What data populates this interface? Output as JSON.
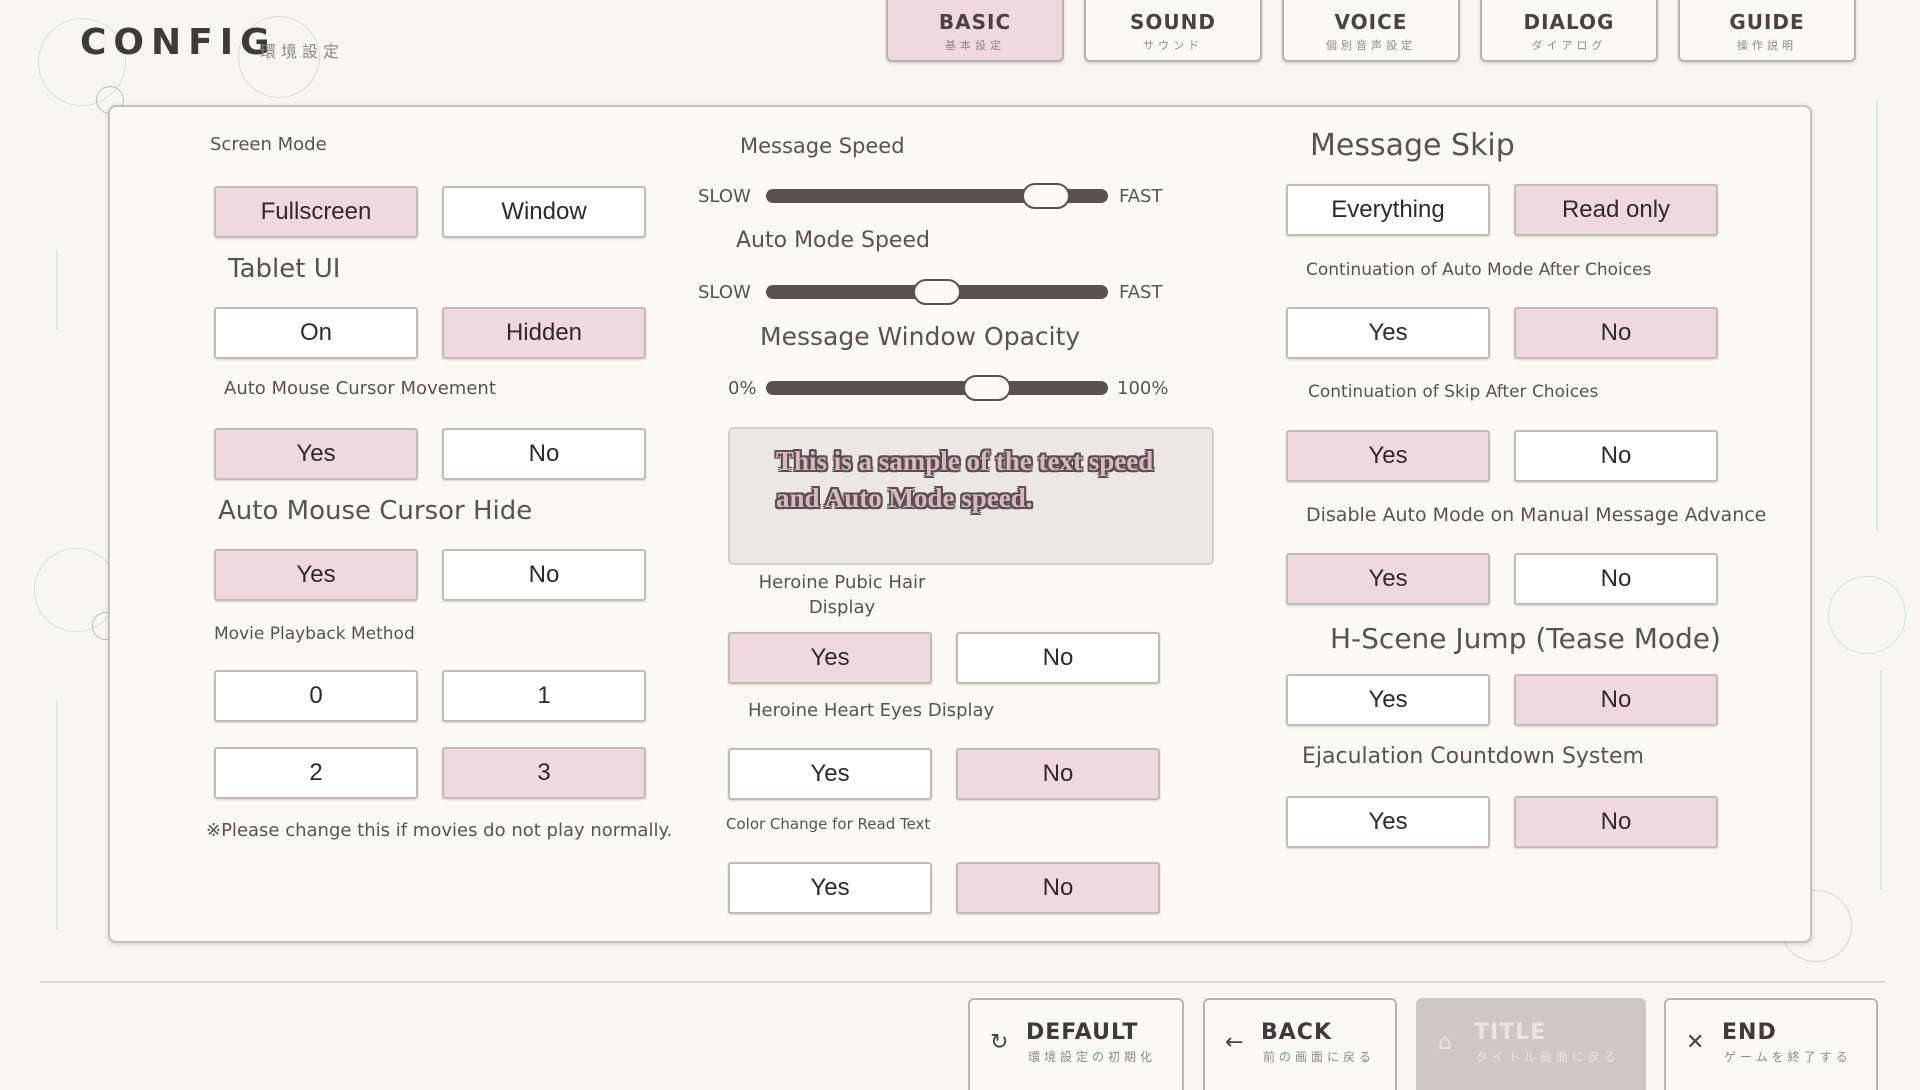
{
  "header": {
    "title": "CONFIG",
    "subtitle": "環境設定",
    "tabs": [
      {
        "label": "BASIC",
        "sub": "基本設定",
        "active": true
      },
      {
        "label": "SOUND",
        "sub": "サウンド",
        "active": false
      },
      {
        "label": "VOICE",
        "sub": "個別音声設定",
        "active": false
      },
      {
        "label": "DIALOG",
        "sub": "ダイアログ",
        "active": false
      },
      {
        "label": "GUIDE",
        "sub": "操作説明",
        "active": false
      }
    ]
  },
  "left": {
    "screen_mode": {
      "label": "Screen Mode",
      "options": [
        "Fullscreen",
        "Window"
      ],
      "selected": "Fullscreen"
    },
    "tablet_ui": {
      "label": "Tablet UI",
      "options": [
        "On",
        "Hidden"
      ],
      "selected": "Hidden"
    },
    "auto_cursor_move": {
      "label": "Auto Mouse Cursor Movement",
      "options": [
        "Yes",
        "No"
      ],
      "selected": "Yes"
    },
    "auto_cursor_hide": {
      "label": "Auto Mouse Cursor Hide",
      "options": [
        "Yes",
        "No"
      ],
      "selected": "Yes"
    },
    "movie_method": {
      "label": "Movie Playback Method",
      "options": [
        "0",
        "1",
        "2",
        "3"
      ],
      "selected": "3",
      "note": "※Please change this if movies do not play normally."
    }
  },
  "middle": {
    "message_speed": {
      "label": "Message Speed",
      "min_label": "SLOW",
      "max_label": "FAST",
      "value": 0.87
    },
    "auto_mode_speed": {
      "label": "Auto Mode Speed",
      "min_label": "SLOW",
      "max_label": "FAST",
      "value": 0.5
    },
    "window_opacity": {
      "label": "Message Window Opacity",
      "min_label": "0%",
      "max_label": "100%",
      "value": 0.67
    },
    "sample_text": "This is a sample of the text speed and Auto Mode speed.",
    "pubic_hair": {
      "label": "Heroine Pubic Hair Display",
      "options": [
        "Yes",
        "No"
      ],
      "selected": "Yes"
    },
    "heart_eyes": {
      "label": "Heroine Heart Eyes Display",
      "options": [
        "Yes",
        "No"
      ],
      "selected": "No"
    },
    "read_color": {
      "label": "Color Change for Read Text",
      "options": [
        "Yes",
        "No"
      ],
      "selected": "No"
    }
  },
  "right": {
    "message_skip": {
      "label": "Message Skip",
      "options": [
        "Everything",
        "Read only"
      ],
      "selected": "Read only"
    },
    "auto_after_choice": {
      "label": "Continuation of Auto Mode After Choices",
      "options": [
        "Yes",
        "No"
      ],
      "selected": "No"
    },
    "skip_after_choice": {
      "label": "Continuation of Skip After Choices",
      "options": [
        "Yes",
        "No"
      ],
      "selected": "Yes"
    },
    "disable_auto": {
      "label": "Disable Auto Mode on Manual Message Advance",
      "options": [
        "Yes",
        "No"
      ],
      "selected": "Yes"
    },
    "hscene_jump": {
      "label": "H-Scene Jump (Tease Mode)",
      "options": [
        "Yes",
        "No"
      ],
      "selected": "No"
    },
    "ejac_countdown": {
      "label": "Ejaculation Countdown System",
      "options": [
        "Yes",
        "No"
      ],
      "selected": "No"
    }
  },
  "footer": {
    "buttons": [
      {
        "label": "DEFAULT",
        "sub": "環境設定の初期化",
        "icon": "reset-icon",
        "glyph": "↻",
        "disabled": false
      },
      {
        "label": "BACK",
        "sub": "前の画面に戻る",
        "icon": "back-arrow-icon",
        "glyph": "←",
        "disabled": false
      },
      {
        "label": "TITLE",
        "sub": "タイトル画面に戻る",
        "icon": "home-icon",
        "glyph": "⌂",
        "disabled": true
      },
      {
        "label": "END",
        "sub": "ゲームを終了する",
        "icon": "close-icon",
        "glyph": "✕",
        "disabled": false
      }
    ]
  },
  "colors": {
    "selected": "#f0d8e0",
    "track": "#5b4f4f",
    "panel_border": "#c6bfbb"
  }
}
